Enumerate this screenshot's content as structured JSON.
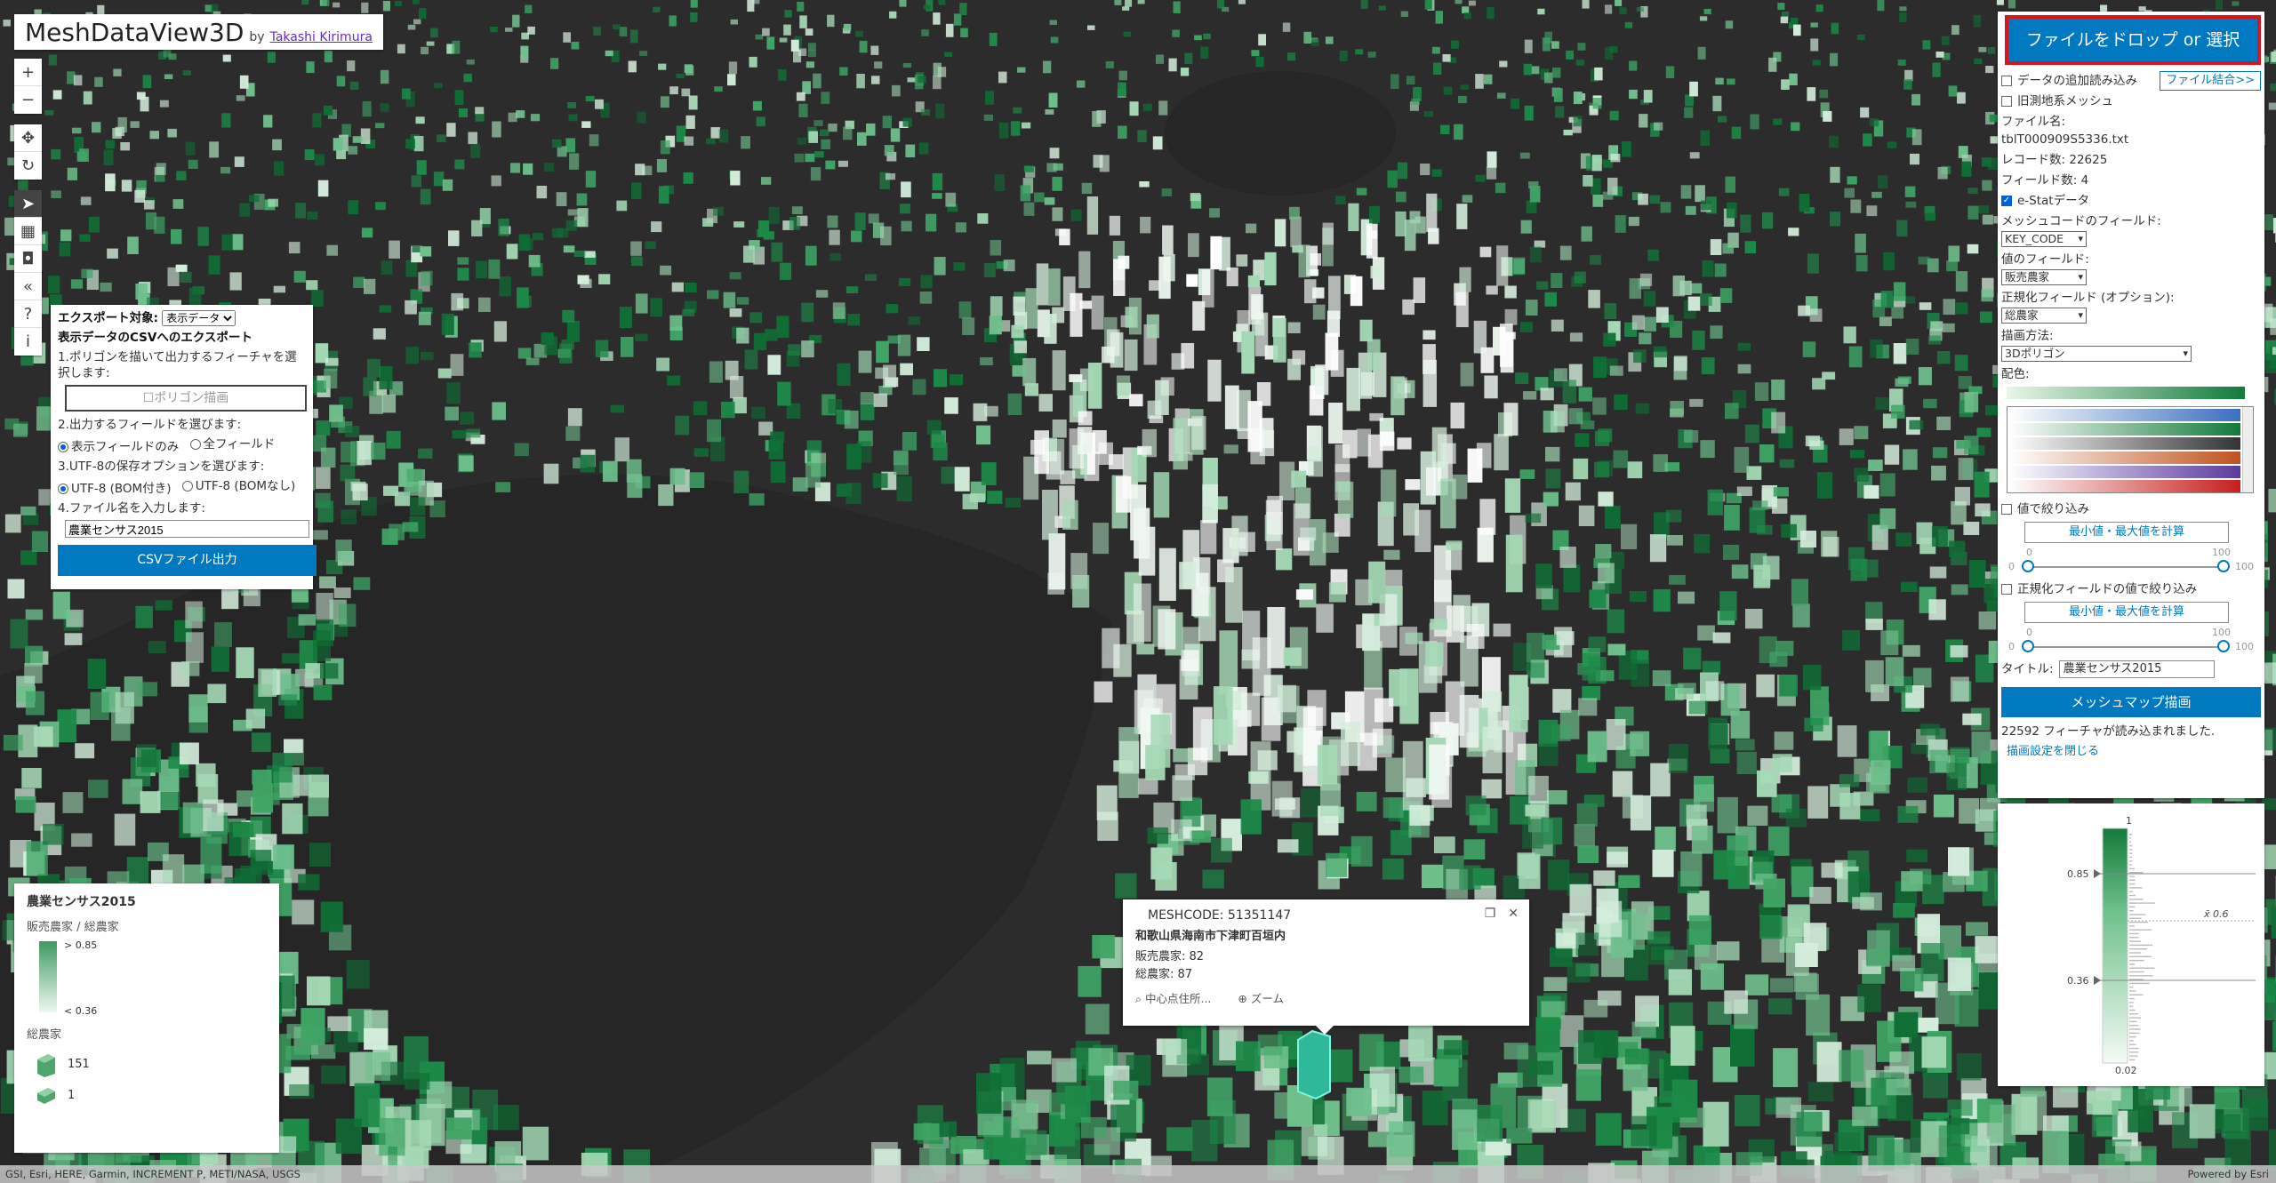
{
  "app": {
    "name": "MeshDataView3D",
    "by": "by",
    "author": "Takashi Kirimura"
  },
  "toolbar": {
    "zoom_in": "+",
    "zoom_out": "−",
    "pan": "✥",
    "rotate": "↻",
    "select": "➤",
    "qr": "▦",
    "camera": "◘",
    "collapse": "«",
    "help": "?",
    "info": "i"
  },
  "export_panel": {
    "target_label": "エクスポート対象:",
    "target_value": "表示データ",
    "heading": "表示データのCSVへのエクスポート",
    "step1": "1.ポリゴンを描いて出力するフィーチャを選択します:",
    "polygon_button": "ポリゴン描画",
    "step2": "2.出力するフィールドを選びます:",
    "field_option1": "表示フィールドのみ",
    "field_option2": "全フィールド",
    "step3": "3.UTF-8の保存オプションを選びます:",
    "utf_option1": "UTF-8 (BOM付き)",
    "utf_option2": "UTF-8 (BOMなし)",
    "step4": "4.ファイル名を入力します:",
    "filename_value": "農業センサス2015",
    "csv_button": "CSVファイル出力"
  },
  "right_panel": {
    "drop_button": "ファイルをドロップ or 選択",
    "append_label": "データの追加読み込み",
    "merge_button": "ファイル結合>>",
    "old_datum_label": "旧測地系メッシュ",
    "filename_label": "ファイル名:",
    "filename_value": "tblT000909S5336.txt",
    "record_label": "レコード数:",
    "record_value": "22625",
    "field_count_label": "フィールド数:",
    "field_count_value": "4",
    "estat_label": "e-Statデータ",
    "meshcode_field_label": "メッシュコードのフィールド:",
    "meshcode_field_value": "KEY_CODE",
    "value_field_label": "値のフィールド:",
    "value_field_value": "販売農家",
    "normalize_field_label": "正規化フィールド (オプション):",
    "normalize_field_value": "総農家",
    "draw_method_label": "描画方法:",
    "draw_method_value": "3Dポリゴン",
    "color_label": "配色:",
    "filter_value_label": "値で絞り込み",
    "calc_button1": "最小値・最大値を計算",
    "slider1_min": "0",
    "slider1_max": "100",
    "slider1_low": "0",
    "slider1_high": "100",
    "filter_norm_label": "正規化フィールドの値で絞り込み",
    "calc_button2": "最小値・最大値を計算",
    "slider2_min": "0",
    "slider2_max": "100",
    "slider2_low": "0",
    "slider2_high": "100",
    "title_label": "タイトル:",
    "title_value": "農業センサス2015",
    "draw_button": "メッシュマップ描画",
    "loaded_message": "22592 フィーチャが読み込まれました.",
    "close_link": "描画設定を閉じる"
  },
  "histogram": {
    "top_label": "1",
    "bottom_label": "0.02",
    "high_handle": "0.85",
    "low_handle": "0.36",
    "x_annotation": "x̄ 0.6"
  },
  "legend": {
    "title": "農業センサス2015",
    "ratio_label": "販売農家 / 総農家",
    "high_label": "> 0.85",
    "low_label": "< 0.36",
    "size_label": "総農家",
    "size_max": "151",
    "size_min": "1"
  },
  "popup": {
    "header": "MESHCODE: 51351147",
    "address": "和歌山県海南市下津町百垣内",
    "attr1": "販売農家: 82",
    "attr2": "総農家: 87",
    "action_center": "中心点住所...",
    "action_zoom": "ズーム"
  },
  "attribution": {
    "sources": "GSI, Esri, HERE, Garmin, INCREMENT P, METI/NASA, USGS",
    "powered": "Powered by Esri"
  },
  "colors": {
    "accent_blue": "#0079c1",
    "drop_border_red": "#d8141f",
    "mesh_dark_green": "#127a3a",
    "mesh_light_green": "#e9f7e9"
  }
}
